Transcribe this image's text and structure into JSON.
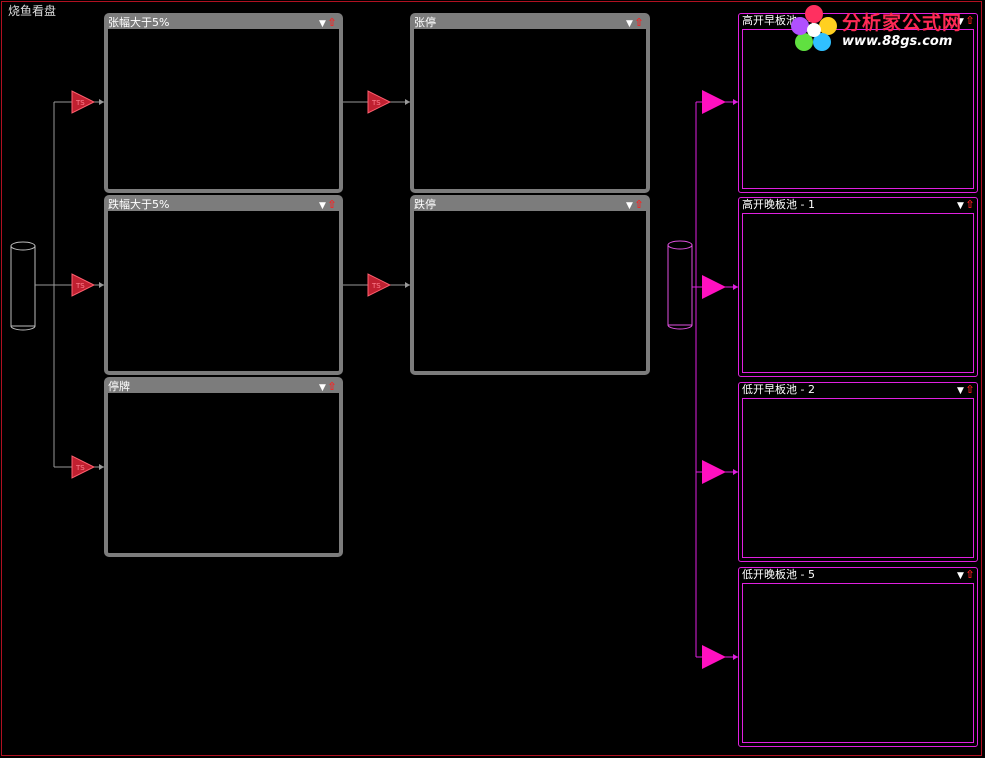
{
  "app": {
    "title": "烧鱼看盘"
  },
  "logo": {
    "name": "分析家公式网",
    "url": "www.88gs.com"
  },
  "icons": {
    "dropdown": "triangle-down-icon",
    "pin": "red-up-arrow-icon"
  },
  "colors": {
    "gray_panel": "#7c7c7c",
    "pink_panel": "#e020e0",
    "filter_triangle": "#c02030",
    "pink_triangle": "#ff10c0"
  },
  "left_panels": [
    {
      "title": "张幅大于5%"
    },
    {
      "title": "跌幅大于5%"
    },
    {
      "title": "停牌"
    }
  ],
  "mid_panels": [
    {
      "title": "张停"
    },
    {
      "title": "跌停"
    }
  ],
  "right_panels": [
    {
      "title": "高开早板池 - 4"
    },
    {
      "title": "高开晚板池 - 1"
    },
    {
      "title": "低开早板池 - 2"
    },
    {
      "title": "低开晚板池 - 5"
    }
  ]
}
